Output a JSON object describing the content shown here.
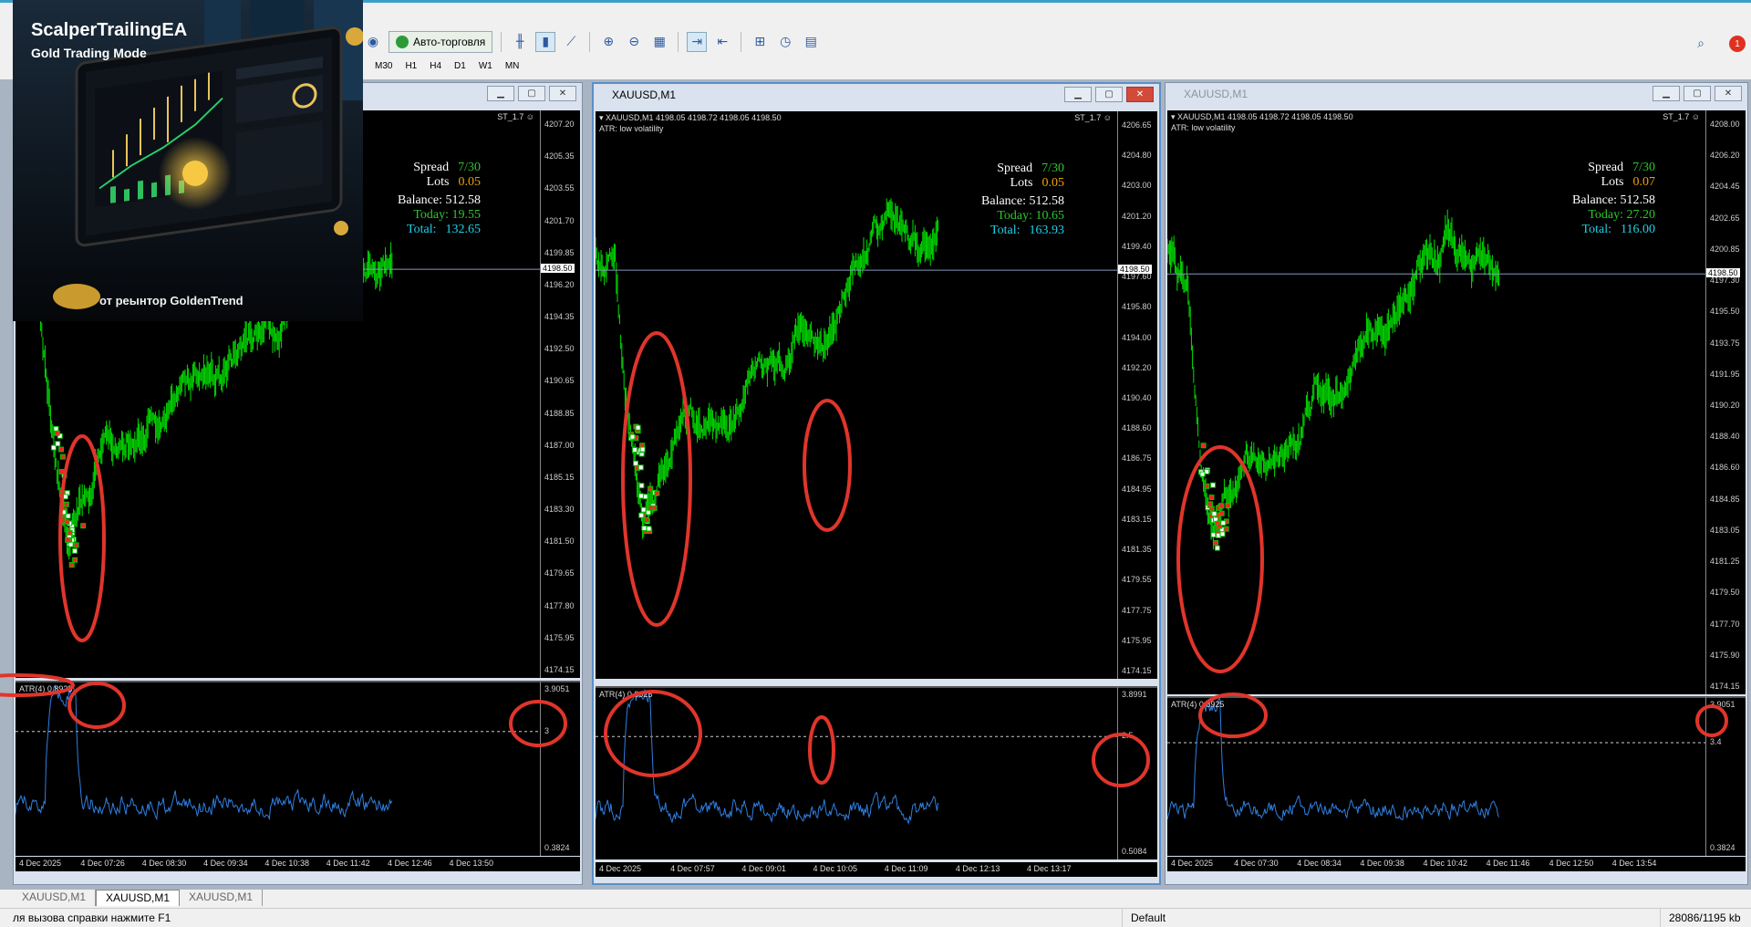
{
  "toolbar": {
    "autotrade_label": "Авто-торговля",
    "timeframes": [
      "M30",
      "H1",
      "H4",
      "D1",
      "W1",
      "MN"
    ],
    "notification_count": "1"
  },
  "promo": {
    "title": "ScalperTrailingEA",
    "subtitle": "Gold Trading Mode",
    "footer": "от реынтор GoldenTrend"
  },
  "windows": [
    {
      "title": "",
      "st": "ST_1.7",
      "header": "",
      "atr_label": "ATR(4) 0.8925",
      "info": {
        "spread_label": "Spread",
        "spread": "7/30",
        "lots_label": "Lots",
        "lots": "0.05",
        "balance": "Balance: 512.58",
        "today": "Today: 19.55",
        "total_label": "Total:",
        "total": "132.65"
      },
      "price_ticks": [
        "4207.20",
        "4205.35",
        "4203.55",
        "4201.70",
        "4199.85",
        "4196.20",
        "4194.35",
        "4192.50",
        "4190.65",
        "4188.85",
        "4187.00",
        "4185.15",
        "4183.30",
        "4181.50",
        "4179.65",
        "4177.80",
        "4175.95",
        "4174.15"
      ],
      "price_marker": "4198.50",
      "atr_ticks": [
        "3.9051",
        "0.3824"
      ],
      "atr_level": "3",
      "x_labels": [
        "4 Dec 2025",
        "4 Dec 07:26",
        "4 Dec 08:30",
        "4 Dec 09:34",
        "4 Dec 10:38",
        "4 Dec 11:42",
        "4 Dec 12:46",
        "4 Dec 13:50"
      ]
    },
    {
      "title": "XAUUSD,M1",
      "st": "ST_1.7",
      "header": "XAUUSD,M1  4198.05 4198.72 4198.05 4198.50",
      "atr_sub": "ATR: low volatility",
      "atr_label": "ATR(4) 0.8925",
      "info": {
        "spread_label": "Spread",
        "spread": "7/30",
        "lots_label": "Lots",
        "lots": "0.05",
        "balance": "Balance: 512.58",
        "today": "Today: 10.65",
        "total_label": "Total:",
        "total": "163.93"
      },
      "price_ticks": [
        "4206.65",
        "4204.80",
        "4203.00",
        "4201.20",
        "4199.40",
        "4197.60",
        "4195.80",
        "4194.00",
        "4192.20",
        "4190.40",
        "4188.60",
        "4186.75",
        "4184.95",
        "4183.15",
        "4181.35",
        "4179.55",
        "4177.75",
        "4175.95",
        "4174.15"
      ],
      "price_marker": "4198.50",
      "atr_ticks": [
        "3.8991",
        "0.5084"
      ],
      "atr_level": "2.5",
      "x_labels": [
        "4 Dec 2025",
        "4 Dec 07:57",
        "4 Dec 09:01",
        "4 Dec 10:05",
        "4 Dec 11:09",
        "4 Dec 12:13",
        "4 Dec 13:17"
      ]
    },
    {
      "title": "XAUUSD,M1",
      "st": "ST_1.7",
      "header": "XAUUSD,M1  4198.05 4198.72 4198.05 4198.50",
      "atr_sub": "ATR: low volatility",
      "atr_label": "ATR(4) 0.8925",
      "info": {
        "spread_label": "Spread",
        "spread": "7/30",
        "lots_label": "Lots",
        "lots": "0.07",
        "balance": "Balance: 512.58",
        "today": "Today: 27.20",
        "total_label": "Total:",
        "total": "116.00"
      },
      "price_ticks": [
        "4208.00",
        "4206.20",
        "4204.45",
        "4202.65",
        "4200.85",
        "4197.30",
        "4195.50",
        "4193.75",
        "4191.95",
        "4190.20",
        "4188.40",
        "4186.60",
        "4184.85",
        "4183.05",
        "4181.25",
        "4179.50",
        "4177.70",
        "4175.90",
        "4174.15"
      ],
      "price_marker": "4198.50",
      "atr_ticks": [
        "3.9051",
        "0.3824"
      ],
      "atr_level": "3.4",
      "x_labels": [
        "4 Dec 2025",
        "4 Dec 07:30",
        "4 Dec 08:34",
        "4 Dec 09:38",
        "4 Dec 10:42",
        "4 Dec 11:46",
        "4 Dec 12:50",
        "4 Dec 13:54"
      ]
    }
  ],
  "tabs": [
    "XAUUSD,M1",
    "XAUUSD,M1",
    "XAUUSD,M1"
  ],
  "status": {
    "help": "ля вызова справки нажмите F1",
    "profile": "Default",
    "traffic": "28086/1195 kb"
  }
}
